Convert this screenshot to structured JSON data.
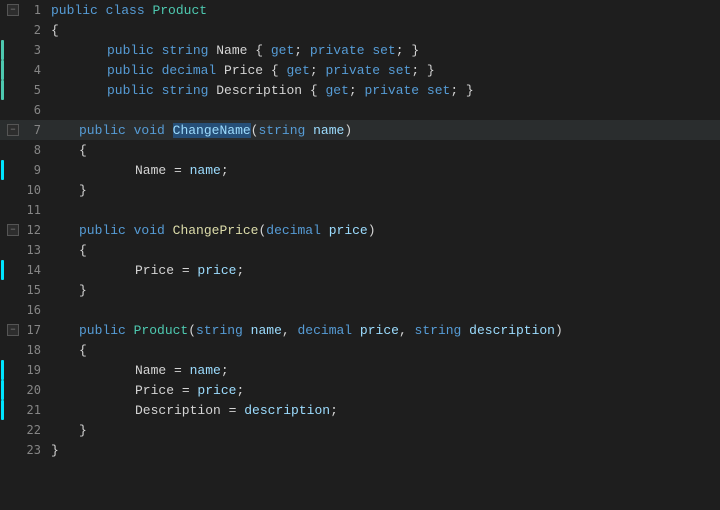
{
  "title": "Product",
  "lines": [
    {
      "ln": 1,
      "fold": "-",
      "foldTop": true,
      "indent": 0,
      "tokens": [
        {
          "t": "kw",
          "v": "public"
        },
        {
          "t": "plain",
          "v": " "
        },
        {
          "t": "kw",
          "v": "class"
        },
        {
          "t": "plain",
          "v": " "
        },
        {
          "t": "type",
          "v": "Product"
        }
      ],
      "indicator": null,
      "highlighted": false
    },
    {
      "ln": 2,
      "fold": "",
      "foldTop": false,
      "indent": 0,
      "tokens": [
        {
          "t": "plain",
          "v": "{"
        }
      ],
      "indicator": null,
      "highlighted": false
    },
    {
      "ln": 3,
      "fold": "",
      "foldTop": false,
      "indent": 2,
      "tokens": [
        {
          "t": "kw",
          "v": "public"
        },
        {
          "t": "plain",
          "v": " "
        },
        {
          "t": "kw",
          "v": "string"
        },
        {
          "t": "plain",
          "v": " "
        },
        {
          "t": "plain",
          "v": "Name"
        },
        {
          "t": "plain",
          "v": " { "
        },
        {
          "t": "kw",
          "v": "get"
        },
        {
          "t": "plain",
          "v": "; "
        },
        {
          "t": "kw",
          "v": "private"
        },
        {
          "t": "plain",
          "v": " "
        },
        {
          "t": "kw",
          "v": "set"
        },
        {
          "t": "plain",
          "v": "; }"
        }
      ],
      "indicator": "green",
      "highlighted": false
    },
    {
      "ln": 4,
      "fold": "",
      "foldTop": false,
      "indent": 2,
      "tokens": [
        {
          "t": "kw",
          "v": "public"
        },
        {
          "t": "plain",
          "v": " "
        },
        {
          "t": "kw",
          "v": "decimal"
        },
        {
          "t": "plain",
          "v": " "
        },
        {
          "t": "plain",
          "v": "Price"
        },
        {
          "t": "plain",
          "v": " { "
        },
        {
          "t": "kw",
          "v": "get"
        },
        {
          "t": "plain",
          "v": "; "
        },
        {
          "t": "kw",
          "v": "private"
        },
        {
          "t": "plain",
          "v": " "
        },
        {
          "t": "kw",
          "v": "set"
        },
        {
          "t": "plain",
          "v": "; }"
        }
      ],
      "indicator": "green",
      "highlighted": false
    },
    {
      "ln": 5,
      "fold": "",
      "foldTop": false,
      "indent": 2,
      "tokens": [
        {
          "t": "kw",
          "v": "public"
        },
        {
          "t": "plain",
          "v": " "
        },
        {
          "t": "kw",
          "v": "string"
        },
        {
          "t": "plain",
          "v": " "
        },
        {
          "t": "plain",
          "v": "Description"
        },
        {
          "t": "plain",
          "v": " { "
        },
        {
          "t": "kw",
          "v": "get"
        },
        {
          "t": "plain",
          "v": "; "
        },
        {
          "t": "kw",
          "v": "private"
        },
        {
          "t": "plain",
          "v": " "
        },
        {
          "t": "kw",
          "v": "set"
        },
        {
          "t": "plain",
          "v": "; }"
        }
      ],
      "indicator": "green",
      "highlighted": false
    },
    {
      "ln": 6,
      "fold": "",
      "foldTop": false,
      "indent": 0,
      "tokens": [],
      "indicator": null,
      "highlighted": false
    },
    {
      "ln": 7,
      "fold": "-",
      "foldTop": true,
      "indent": 1,
      "tokens": [
        {
          "t": "kw",
          "v": "public"
        },
        {
          "t": "plain",
          "v": " "
        },
        {
          "t": "kw",
          "v": "void"
        },
        {
          "t": "plain",
          "v": " "
        },
        {
          "t": "method-highlight",
          "v": "ChangeName"
        },
        {
          "t": "plain",
          "v": "("
        },
        {
          "t": "kw",
          "v": "string"
        },
        {
          "t": "plain",
          "v": " "
        },
        {
          "t": "param",
          "v": "name"
        },
        {
          "t": "plain",
          "v": ")"
        }
      ],
      "indicator": null,
      "highlighted": true
    },
    {
      "ln": 8,
      "fold": "",
      "foldTop": false,
      "indent": 1,
      "tokens": [
        {
          "t": "plain",
          "v": "{"
        }
      ],
      "indicator": null,
      "highlighted": false
    },
    {
      "ln": 9,
      "fold": "",
      "foldTop": false,
      "indent": 3,
      "tokens": [
        {
          "t": "plain",
          "v": "Name"
        },
        {
          "t": "plain",
          "v": " = "
        },
        {
          "t": "param",
          "v": "name"
        },
        {
          "t": "plain",
          "v": ";"
        }
      ],
      "indicator": "cyan",
      "highlighted": false
    },
    {
      "ln": 10,
      "fold": "",
      "foldTop": false,
      "indent": 1,
      "tokens": [
        {
          "t": "plain",
          "v": "}"
        }
      ],
      "indicator": null,
      "highlighted": false
    },
    {
      "ln": 11,
      "fold": "",
      "foldTop": false,
      "indent": 0,
      "tokens": [],
      "indicator": null,
      "highlighted": false
    },
    {
      "ln": 12,
      "fold": "-",
      "foldTop": true,
      "indent": 1,
      "tokens": [
        {
          "t": "kw",
          "v": "public"
        },
        {
          "t": "plain",
          "v": " "
        },
        {
          "t": "kw",
          "v": "void"
        },
        {
          "t": "plain",
          "v": " "
        },
        {
          "t": "method",
          "v": "ChangePrice"
        },
        {
          "t": "plain",
          "v": "("
        },
        {
          "t": "kw",
          "v": "decimal"
        },
        {
          "t": "plain",
          "v": " "
        },
        {
          "t": "param",
          "v": "price"
        },
        {
          "t": "plain",
          "v": ")"
        }
      ],
      "indicator": null,
      "highlighted": false
    },
    {
      "ln": 13,
      "fold": "",
      "foldTop": false,
      "indent": 1,
      "tokens": [
        {
          "t": "plain",
          "v": "{"
        }
      ],
      "indicator": null,
      "highlighted": false
    },
    {
      "ln": 14,
      "fold": "",
      "foldTop": false,
      "indent": 3,
      "tokens": [
        {
          "t": "plain",
          "v": "Price"
        },
        {
          "t": "plain",
          "v": " = "
        },
        {
          "t": "param",
          "v": "price"
        },
        {
          "t": "plain",
          "v": ";"
        }
      ],
      "indicator": "cyan",
      "highlighted": false
    },
    {
      "ln": 15,
      "fold": "",
      "foldTop": false,
      "indent": 1,
      "tokens": [
        {
          "t": "plain",
          "v": "}"
        }
      ],
      "indicator": null,
      "highlighted": false
    },
    {
      "ln": 16,
      "fold": "",
      "foldTop": false,
      "indent": 0,
      "tokens": [],
      "indicator": null,
      "highlighted": false
    },
    {
      "ln": 17,
      "fold": "-",
      "foldTop": true,
      "indent": 1,
      "tokens": [
        {
          "t": "kw",
          "v": "public"
        },
        {
          "t": "plain",
          "v": " "
        },
        {
          "t": "type",
          "v": "Product"
        },
        {
          "t": "plain",
          "v": "("
        },
        {
          "t": "kw",
          "v": "string"
        },
        {
          "t": "plain",
          "v": " "
        },
        {
          "t": "param",
          "v": "name"
        },
        {
          "t": "plain",
          "v": ", "
        },
        {
          "t": "kw",
          "v": "decimal"
        },
        {
          "t": "plain",
          "v": " "
        },
        {
          "t": "param",
          "v": "price"
        },
        {
          "t": "plain",
          "v": ", "
        },
        {
          "t": "kw",
          "v": "string"
        },
        {
          "t": "plain",
          "v": " "
        },
        {
          "t": "param",
          "v": "description"
        },
        {
          "t": "plain",
          "v": ")"
        }
      ],
      "indicator": null,
      "highlighted": false
    },
    {
      "ln": 18,
      "fold": "",
      "foldTop": false,
      "indent": 1,
      "tokens": [
        {
          "t": "plain",
          "v": "{"
        }
      ],
      "indicator": null,
      "highlighted": false
    },
    {
      "ln": 19,
      "fold": "",
      "foldTop": false,
      "indent": 3,
      "tokens": [
        {
          "t": "plain",
          "v": "Name"
        },
        {
          "t": "plain",
          "v": " = "
        },
        {
          "t": "param",
          "v": "name"
        },
        {
          "t": "plain",
          "v": ";"
        }
      ],
      "indicator": "cyan",
      "highlighted": false
    },
    {
      "ln": 20,
      "fold": "",
      "foldTop": false,
      "indent": 3,
      "tokens": [
        {
          "t": "plain",
          "v": "Price"
        },
        {
          "t": "plain",
          "v": " = "
        },
        {
          "t": "param",
          "v": "price"
        },
        {
          "t": "plain",
          "v": ";"
        }
      ],
      "indicator": "cyan",
      "highlighted": false
    },
    {
      "ln": 21,
      "fold": "",
      "foldTop": false,
      "indent": 3,
      "tokens": [
        {
          "t": "plain",
          "v": "Description"
        },
        {
          "t": "plain",
          "v": " = "
        },
        {
          "t": "param",
          "v": "description"
        },
        {
          "t": "plain",
          "v": ";"
        }
      ],
      "indicator": "cyan",
      "highlighted": false
    },
    {
      "ln": 22,
      "fold": "",
      "foldTop": false,
      "indent": 1,
      "tokens": [
        {
          "t": "plain",
          "v": "}"
        }
      ],
      "indicator": null,
      "highlighted": false
    },
    {
      "ln": 23,
      "fold": "",
      "foldTop": false,
      "indent": 0,
      "tokens": [
        {
          "t": "plain",
          "v": "}"
        }
      ],
      "indicator": null,
      "highlighted": false
    }
  ],
  "indent_size": 28,
  "colors": {
    "kw": "#569cd6",
    "kw2": "#c586c0",
    "type": "#4ec9b0",
    "method": "#dcdcaa",
    "method-highlight-text": "#9cdcfe",
    "method-highlight-bg": "#264f78",
    "param": "#9cdcfe",
    "plain": "#d4d4d4",
    "green_bar": "#4ec9b0",
    "cyan_bar": "#00e5ff",
    "bg": "#1e1e1e",
    "highlighted_row": "#2a2d2e",
    "ln_color": "#858585"
  }
}
